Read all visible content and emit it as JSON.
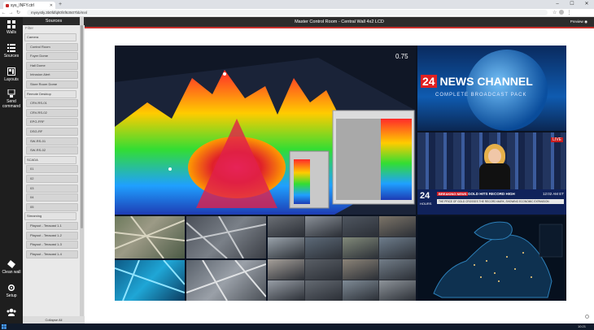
{
  "browser": {
    "tab_title": "sys_INFY.ctrl",
    "new_tab": "+",
    "url": "mysystly.3b0fdfqlt0f4f63507bb/mnl",
    "window_buttons": [
      "–",
      "☐",
      "✕"
    ]
  },
  "leftnav": [
    {
      "label": "Walls",
      "icon": "grid-icon"
    },
    {
      "label": "Sources",
      "icon": "list-icon"
    },
    {
      "label": "Layouts",
      "icon": "layout-icon"
    },
    {
      "label": "Send command",
      "icon": "send-command-icon"
    },
    {
      "label": "Clean wall",
      "icon": "eraser-icon"
    },
    {
      "label": "Setup",
      "icon": "gear-icon"
    },
    {
      "label": "",
      "icon": "users-icon"
    }
  ],
  "sources": {
    "header": "Sources",
    "filter": "Filter",
    "items": [
      {
        "label": "Camera",
        "group": true
      },
      {
        "label": "Control Room"
      },
      {
        "label": "Foyer Dome"
      },
      {
        "label": "Hall Dome"
      },
      {
        "label": "Intrusion Alert"
      },
      {
        "label": "Store Room Dome"
      },
      {
        "label": "Remote Desktop",
        "group": true
      },
      {
        "label": "CRV-RS-01"
      },
      {
        "label": "CRV-RS-02"
      },
      {
        "label": "EPG-FRF"
      },
      {
        "label": "DSG-RF"
      },
      {
        "label": "SW-RS-01"
      },
      {
        "label": "SW-RS-02"
      },
      {
        "label": "SCADA",
        "group": true
      },
      {
        "label": "01"
      },
      {
        "label": "02"
      },
      {
        "label": "03"
      },
      {
        "label": "04"
      },
      {
        "label": "05"
      },
      {
        "label": "Streaming",
        "group": true
      },
      {
        "label": "Playout - Teracast 1-1"
      },
      {
        "label": "Playout - Teracast 1-2"
      },
      {
        "label": "Playout - Teracast 1-3"
      },
      {
        "label": "Playout - Teracast 1-4"
      }
    ],
    "footer": "Collapse All"
  },
  "main": {
    "title": "Master Control Room - Central Wall 4x2 LCD",
    "preview": "Preview"
  },
  "wall": {
    "plot_label": "0.75",
    "news_channel": {
      "number": "24",
      "title": "NEWS CHANNEL",
      "subtitle": "COMPLETE BROADCAST PACK"
    },
    "news_desk": {
      "live": "LIVE",
      "brand_top": "24",
      "brand_bottom": "HOURS",
      "breaking": "BREAKING NEWS",
      "headline": "GOLD HITS RECORD HIGH",
      "time": "12:02 AM ET",
      "ticker": "THE PRICE OF GOLD CROSSES THE RECORD MARK, SHOWING ECONOMIC EXPANSION"
    }
  },
  "taskbar": {
    "clock": "10:21"
  },
  "colors": {
    "accent": "#c9302c",
    "nav_bg": "#1e1e1e",
    "titlebar": "#2c2c2c"
  }
}
